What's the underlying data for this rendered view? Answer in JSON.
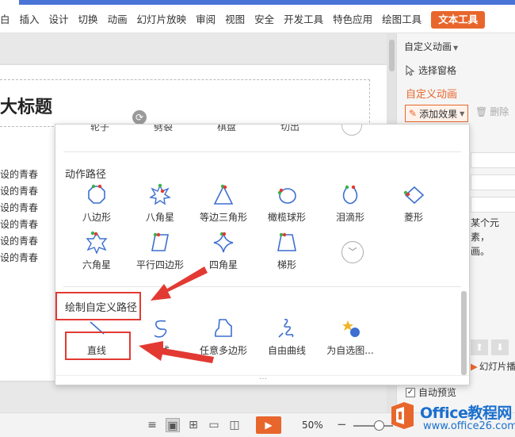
{
  "ribbon": {
    "tabs": [
      "白",
      "插入",
      "设计",
      "切换",
      "动画",
      "幻灯片放映",
      "审阅",
      "视图",
      "安全",
      "开发工具",
      "特色应用",
      "绘图工具",
      "文本工具"
    ],
    "active_tab_color": "#e8662c"
  },
  "slide": {
    "title": "大标题",
    "bullets": [
      "设的青春",
      "设的青春",
      "设的青春",
      "设的青春",
      "设的青春",
      "设的青春"
    ]
  },
  "pane": {
    "title": "自定义动画",
    "select_pane": "选择窗格",
    "heading": "自定义动画",
    "add_effect": "添加效果",
    "delete": "删除",
    "hint_line1": "某个元素，",
    "hint_line2": "画。",
    "slideshow": "幻灯片播",
    "autopreview": "自动预览",
    "autopreview_checked": "✓"
  },
  "dropdown": {
    "top_partial_items": [
      "轮子",
      "劈裂",
      "棋盘",
      "切出"
    ],
    "motion_section": "动作路径",
    "motion_items": [
      "八边形",
      "八角星",
      "等边三角形",
      "橄榄球形",
      "泪滴形",
      "菱形",
      "六角星",
      "平行四边形",
      "四角星",
      "梯形"
    ],
    "custom_section": "绘制自定义路径",
    "custom_items": [
      "直线",
      "曲线",
      "任意多边形",
      "自由曲线",
      "为自选图..."
    ],
    "more_icon": "chevron-down-icon",
    "bottom_grip": "···"
  },
  "statusbar": {
    "zoom": "50%",
    "zoom_minus": "−"
  },
  "watermark": {
    "line1_a": "Office",
    "line1_b": "教程网",
    "line2": "www.office26.com"
  },
  "colors": {
    "accent": "#e8662c",
    "annotation": "#e23a33",
    "icon_blue": "#3d6fd1"
  }
}
